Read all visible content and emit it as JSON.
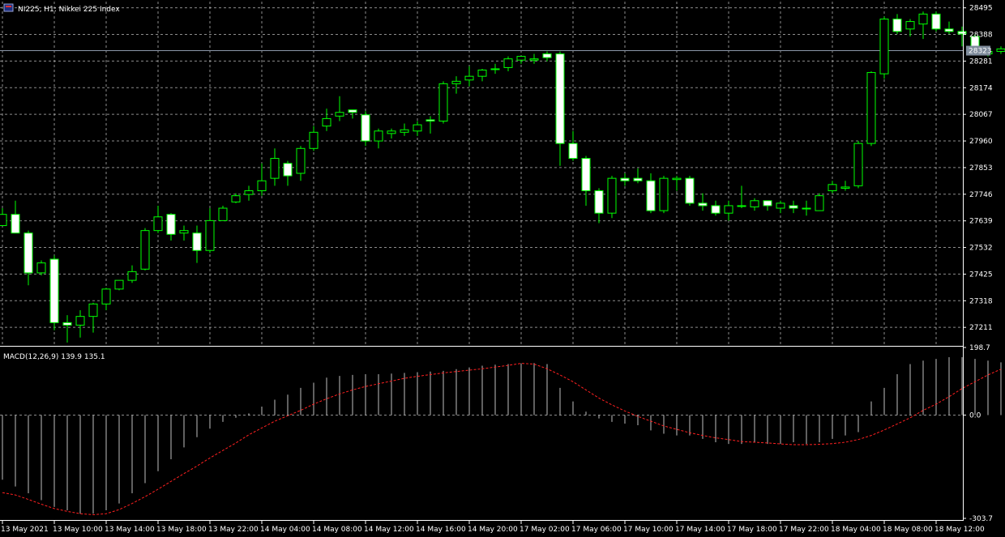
{
  "header": {
    "symbol_text": "NI225, H1:  Nikkei 225 Index"
  },
  "macd_header": {
    "label": "MACD(12,26,9) 139.9 135.1"
  },
  "colors": {
    "background": "#000000",
    "grid": "#c8c8c8",
    "frame": "#ffffff",
    "bull_body": "#000000",
    "bull_outline": "#00ff00",
    "bear_body": "#ffffff",
    "wick": "#00ff00",
    "macd_hist": "#c0c0c0",
    "macd_signal": "#ff2020",
    "current_price_tag": "#7f8c9c"
  },
  "chart_data": [
    {
      "type": "candlestick",
      "title": "NI225, H1:  Nikkei 225 Index",
      "y_ticks": [
        28495,
        28388,
        28281,
        28174,
        28067,
        27960,
        27853,
        27746,
        27639,
        27532,
        27425,
        27318,
        27211
      ],
      "ylim": [
        27140,
        28520
      ],
      "current_price": 28323,
      "current_price_label": "28323",
      "grid": true,
      "candles": [
        {
          "o": 27620,
          "h": 27690,
          "l": 27620,
          "c": 27665
        },
        {
          "o": 27665,
          "h": 27720,
          "l": 27590,
          "c": 27590
        },
        {
          "o": 27590,
          "h": 27600,
          "l": 27380,
          "c": 27430
        },
        {
          "o": 27430,
          "h": 27480,
          "l": 27420,
          "c": 27470
        },
        {
          "o": 27485,
          "h": 27500,
          "l": 27200,
          "c": 27230
        },
        {
          "o": 27230,
          "h": 27260,
          "l": 27150,
          "c": 27220
        },
        {
          "o": 27220,
          "h": 27280,
          "l": 27170,
          "c": 27255
        },
        {
          "o": 27255,
          "h": 27310,
          "l": 27190,
          "c": 27305
        },
        {
          "o": 27305,
          "h": 27370,
          "l": 27280,
          "c": 27365
        },
        {
          "o": 27365,
          "h": 27400,
          "l": 27360,
          "c": 27400
        },
        {
          "o": 27400,
          "h": 27460,
          "l": 27390,
          "c": 27435
        },
        {
          "o": 27445,
          "h": 27610,
          "l": 27440,
          "c": 27600
        },
        {
          "o": 27600,
          "h": 27700,
          "l": 27590,
          "c": 27655
        },
        {
          "o": 27665,
          "h": 27670,
          "l": 27560,
          "c": 27585
        },
        {
          "o": 27590,
          "h": 27620,
          "l": 27560,
          "c": 27600
        },
        {
          "o": 27590,
          "h": 27620,
          "l": 27470,
          "c": 27520
        },
        {
          "o": 27520,
          "h": 27690,
          "l": 27510,
          "c": 27640
        },
        {
          "o": 27640,
          "h": 27700,
          "l": 27640,
          "c": 27690
        },
        {
          "o": 27715,
          "h": 27750,
          "l": 27710,
          "c": 27740
        },
        {
          "o": 27745,
          "h": 27780,
          "l": 27720,
          "c": 27760
        },
        {
          "o": 27760,
          "h": 27870,
          "l": 27740,
          "c": 27800
        },
        {
          "o": 27810,
          "h": 27930,
          "l": 27780,
          "c": 27890
        },
        {
          "o": 27870,
          "h": 27880,
          "l": 27780,
          "c": 27820
        },
        {
          "o": 27830,
          "h": 27940,
          "l": 27800,
          "c": 27930
        },
        {
          "o": 27930,
          "h": 28020,
          "l": 27920,
          "c": 27995
        },
        {
          "o": 28020,
          "h": 28090,
          "l": 28000,
          "c": 28050
        },
        {
          "o": 28060,
          "h": 28140,
          "l": 28040,
          "c": 28075
        },
        {
          "o": 28085,
          "h": 28080,
          "l": 28050,
          "c": 28075
        },
        {
          "o": 28065,
          "h": 28080,
          "l": 27940,
          "c": 27960
        },
        {
          "o": 27960,
          "h": 28010,
          "l": 27930,
          "c": 28000
        },
        {
          "o": 27990,
          "h": 28010,
          "l": 27970,
          "c": 28000
        },
        {
          "o": 27995,
          "h": 28030,
          "l": 27980,
          "c": 28005
        },
        {
          "o": 28000,
          "h": 28040,
          "l": 27980,
          "c": 28025
        },
        {
          "o": 28045,
          "h": 28060,
          "l": 27990,
          "c": 28040
        },
        {
          "o": 28040,
          "h": 28200,
          "l": 28030,
          "c": 28190
        },
        {
          "o": 28190,
          "h": 28220,
          "l": 28150,
          "c": 28200
        },
        {
          "o": 28205,
          "h": 28260,
          "l": 28180,
          "c": 28220
        },
        {
          "o": 28220,
          "h": 28250,
          "l": 28200,
          "c": 28245
        },
        {
          "o": 28250,
          "h": 28270,
          "l": 28230,
          "c": 28250
        },
        {
          "o": 28255,
          "h": 28300,
          "l": 28240,
          "c": 28290
        },
        {
          "o": 28285,
          "h": 28300,
          "l": 28270,
          "c": 28300
        },
        {
          "o": 28285,
          "h": 28310,
          "l": 28270,
          "c": 28290
        },
        {
          "o": 28310,
          "h": 28320,
          "l": 28280,
          "c": 28295
        },
        {
          "o": 28310,
          "h": 28320,
          "l": 27860,
          "c": 27950
        },
        {
          "o": 27950,
          "h": 28000,
          "l": 27880,
          "c": 27890
        },
        {
          "o": 27890,
          "h": 27900,
          "l": 27700,
          "c": 27760
        },
        {
          "o": 27760,
          "h": 27770,
          "l": 27630,
          "c": 27670
        },
        {
          "o": 27670,
          "h": 27820,
          "l": 27650,
          "c": 27810
        },
        {
          "o": 27810,
          "h": 27830,
          "l": 27780,
          "c": 27800
        },
        {
          "o": 27810,
          "h": 27850,
          "l": 27790,
          "c": 27800
        },
        {
          "o": 27800,
          "h": 27830,
          "l": 27670,
          "c": 27680
        },
        {
          "o": 27680,
          "h": 27820,
          "l": 27670,
          "c": 27810
        },
        {
          "o": 27805,
          "h": 27820,
          "l": 27760,
          "c": 27810
        },
        {
          "o": 27810,
          "h": 27820,
          "l": 27700,
          "c": 27710
        },
        {
          "o": 27710,
          "h": 27750,
          "l": 27680,
          "c": 27700
        },
        {
          "o": 27700,
          "h": 27720,
          "l": 27660,
          "c": 27670
        },
        {
          "o": 27670,
          "h": 27720,
          "l": 27640,
          "c": 27700
        },
        {
          "o": 27700,
          "h": 27780,
          "l": 27690,
          "c": 27700
        },
        {
          "o": 27695,
          "h": 27730,
          "l": 27680,
          "c": 27720
        },
        {
          "o": 27720,
          "h": 27720,
          "l": 27680,
          "c": 27700
        },
        {
          "o": 27690,
          "h": 27720,
          "l": 27670,
          "c": 27710
        },
        {
          "o": 27700,
          "h": 27720,
          "l": 27670,
          "c": 27690
        },
        {
          "o": 27690,
          "h": 27720,
          "l": 27660,
          "c": 27690
        },
        {
          "o": 27680,
          "h": 27750,
          "l": 27680,
          "c": 27740
        },
        {
          "o": 27760,
          "h": 27800,
          "l": 27750,
          "c": 27785
        },
        {
          "o": 27770,
          "h": 27800,
          "l": 27760,
          "c": 27775
        },
        {
          "o": 27780,
          "h": 27960,
          "l": 27770,
          "c": 27950
        },
        {
          "o": 27950,
          "h": 28240,
          "l": 27940,
          "c": 28235
        },
        {
          "o": 28230,
          "h": 28460,
          "l": 28210,
          "c": 28450
        },
        {
          "o": 28450,
          "h": 28470,
          "l": 28390,
          "c": 28400
        },
        {
          "o": 28410,
          "h": 28450,
          "l": 28380,
          "c": 28440
        },
        {
          "o": 28430,
          "h": 28480,
          "l": 28370,
          "c": 28470
        },
        {
          "o": 28470,
          "h": 28480,
          "l": 28400,
          "c": 28410
        },
        {
          "o": 28410,
          "h": 28440,
          "l": 28390,
          "c": 28400
        },
        {
          "o": 28400,
          "h": 28420,
          "l": 28340,
          "c": 28390
        },
        {
          "o": 28380,
          "h": 28390,
          "l": 28310,
          "c": 28320
        },
        {
          "o": 28310,
          "h": 28340,
          "l": 28300,
          "c": 28320
        },
        {
          "o": 28320,
          "h": 28340,
          "l": 28310,
          "c": 28330
        }
      ],
      "x_ticks": [
        {
          "index": 0,
          "label": "13 May 2021"
        },
        {
          "index": 4,
          "label": "13 May 10:00"
        },
        {
          "index": 8,
          "label": "13 May 14:00"
        },
        {
          "index": 12,
          "label": "13 May 18:00"
        },
        {
          "index": 16,
          "label": "13 May 22:00"
        },
        {
          "index": 20,
          "label": "14 May 04:00"
        },
        {
          "index": 24,
          "label": "14 May 08:00"
        },
        {
          "index": 28,
          "label": "14 May 12:00"
        },
        {
          "index": 32,
          "label": "14 May 16:00"
        },
        {
          "index": 36,
          "label": "14 May 20:00"
        },
        {
          "index": 40,
          "label": "17 May 02:00"
        },
        {
          "index": 44,
          "label": "17 May 06:00"
        },
        {
          "index": 48,
          "label": "17 May 10:00"
        },
        {
          "index": 52,
          "label": "17 May 14:00"
        },
        {
          "index": 56,
          "label": "17 May 18:00"
        },
        {
          "index": 60,
          "label": "17 May 22:00"
        },
        {
          "index": 64,
          "label": "18 May 04:00"
        },
        {
          "index": 68,
          "label": "18 May 08:00"
        },
        {
          "index": 72,
          "label": "18 May 12:00"
        }
      ]
    },
    {
      "type": "macd",
      "title": "MACD(12,26,9) 139.9 135.1",
      "y_ticks": [
        198.7,
        0.0,
        -303.7
      ],
      "y_tick_labels": [
        "198.7",
        "0.0",
        "-303.7"
      ],
      "ylim": [
        -303.7,
        198.7
      ],
      "histogram": [
        -190,
        -210,
        -230,
        -250,
        -270,
        -280,
        -290,
        -290,
        -280,
        -260,
        -230,
        -200,
        -165,
        -130,
        -95,
        -65,
        -40,
        -20,
        -8,
        5,
        25,
        45,
        60,
        80,
        95,
        110,
        115,
        118,
        120,
        120,
        122,
        124,
        126,
        128,
        130,
        135,
        140,
        145,
        148,
        150,
        152,
        153,
        150,
        80,
        40,
        10,
        -10,
        -20,
        -25,
        -30,
        -45,
        -55,
        -60,
        -60,
        -70,
        -80,
        -85,
        -85,
        -80,
        -85,
        -85,
        -80,
        -85,
        -80,
        -70,
        -60,
        -50,
        40,
        80,
        120,
        150,
        160,
        165,
        170,
        170,
        165,
        160,
        155
      ],
      "signal": [
        -228,
        -235,
        -248,
        -262,
        -275,
        -283,
        -290,
        -293,
        -290,
        -278,
        -260,
        -240,
        -218,
        -195,
        -172,
        -150,
        -126,
        -104,
        -82,
        -58,
        -38,
        -18,
        -2,
        14,
        32,
        48,
        62,
        74,
        84,
        92,
        100,
        108,
        114,
        119,
        124,
        128,
        132,
        136,
        141,
        146,
        152,
        150,
        136,
        118,
        98,
        74,
        50,
        30,
        12,
        -4,
        -18,
        -32,
        -42,
        -52,
        -60,
        -67,
        -72,
        -78,
        -80,
        -82,
        -85,
        -87,
        -87,
        -86,
        -84,
        -80,
        -72,
        -60,
        -44,
        -26,
        -8,
        14,
        32,
        54,
        78,
        98,
        118,
        135
      ]
    }
  ]
}
